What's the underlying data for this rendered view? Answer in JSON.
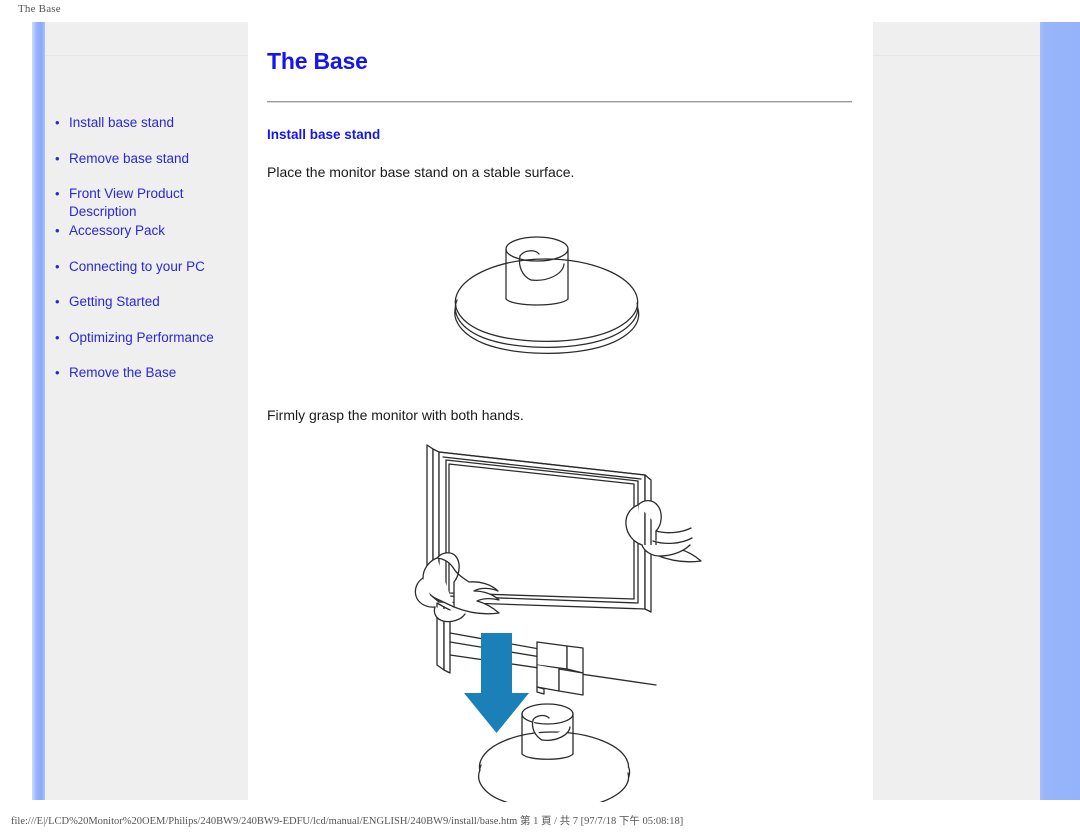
{
  "page_header": "The Base",
  "sidebar": {
    "items": [
      {
        "label": "Install base stand",
        "spacing": "gap"
      },
      {
        "label": "Remove base stand",
        "spacing": "normal"
      },
      {
        "label": "Front View Product Description",
        "spacing": "tight"
      },
      {
        "label": "Accessory Pack",
        "spacing": "gap"
      },
      {
        "label": "Connecting to your PC",
        "spacing": "normal"
      },
      {
        "label": "Getting Started",
        "spacing": "gap"
      },
      {
        "label": "Optimizing Performance",
        "spacing": "normal"
      },
      {
        "label": "Remove the Base",
        "spacing": "normal"
      }
    ],
    "bullet": "•"
  },
  "content": {
    "title": "The Base",
    "section_heading": "Install base stand",
    "paragraph_1": "Place the monitor base stand on a stable surface.",
    "paragraph_2": "Firmly grasp the monitor with both hands.",
    "figure_1_name": "monitor-base-stand-illustration",
    "figure_2_name": "monitor-mounting-onto-base-illustration"
  },
  "colors": {
    "link_blue": "#2828d8",
    "heading_blue": "#1515ef",
    "panel_gray": "#efefef",
    "bar_blue": "#95b3fa",
    "arrow_blue": "#1b7fb8",
    "line_art": "#2b2b2b"
  },
  "footer": {
    "text": "file:///E|/LCD%20Monitor%20OEM/Philips/240BW9/240BW9-EDFU/lcd/manual/ENGLISH/240BW9/install/base.htm 第 1 頁 / 共 7 [97/7/18 下午 05:08:18]"
  }
}
